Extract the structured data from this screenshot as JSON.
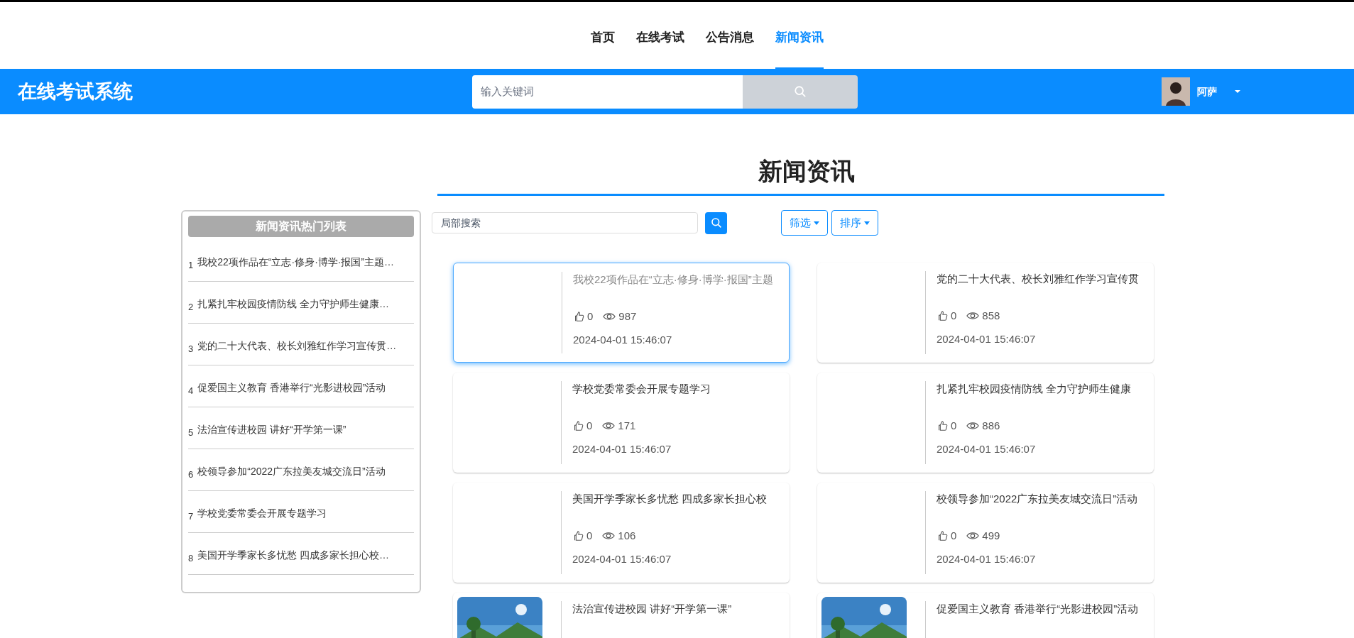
{
  "nav": [
    {
      "label": "首页",
      "selected": false
    },
    {
      "label": "在线考试",
      "selected": false
    },
    {
      "label": "公告消息",
      "selected": false
    },
    {
      "label": "新闻资讯",
      "selected": true
    }
  ],
  "header": {
    "title": "在线考试系统",
    "search": {
      "placeholder": "输入关键词"
    },
    "user": {
      "name": "阿萨"
    }
  },
  "page_title": "新闻资讯",
  "hot_list": {
    "title": "新闻资讯热门列表",
    "items": [
      {
        "rank": "1",
        "title": "我校22项作品在“立志·修身·博学·报国”主题…"
      },
      {
        "rank": "2",
        "title": "扎紧扎牢校园疫情防线 全力守护师生健康…"
      },
      {
        "rank": "3",
        "title": "党的二十大代表、校长刘雅红作学习宣传贯…"
      },
      {
        "rank": "4",
        "title": "促爱国主义教育 香港举行“光影进校园”活动"
      },
      {
        "rank": "5",
        "title": "法治宣传进校园 讲好“开学第一课”"
      },
      {
        "rank": "6",
        "title": "校领导参加“2022广东拉美友城交流日”活动"
      },
      {
        "rank": "7",
        "title": "学校党委常委会开展专题学习"
      },
      {
        "rank": "8",
        "title": "美国开学季家长多忧愁 四成多家长担心校…"
      }
    ]
  },
  "toolbar": {
    "search": {
      "placeholder": "局部搜索"
    },
    "buttons": [
      "筛选",
      "排序"
    ]
  },
  "cards": [
    {
      "title": "我校22项作品在“立志·修身·博学·报国”主题",
      "likes": "0",
      "views": "987",
      "date": "2024-04-01 15:46:07",
      "hovered": true
    },
    {
      "title": "党的二十大代表、校长刘雅红作学习宣传贯",
      "likes": "0",
      "views": "858",
      "date": "2024-04-01 15:46:07",
      "hovered": false
    },
    {
      "title": "学校党委常委会开展专题学习",
      "likes": "0",
      "views": "171",
      "date": "2024-04-01 15:46:07",
      "hovered": false
    },
    {
      "title": "扎紧扎牢校园疫情防线 全力守护师生健康",
      "likes": "0",
      "views": "886",
      "date": "2024-04-01 15:46:07",
      "hovered": false
    },
    {
      "title": "美国开学季家长多忧愁 四成多家长担心校",
      "likes": "0",
      "views": "106",
      "date": "2024-04-01 15:46:07",
      "hovered": false
    },
    {
      "title": "校领导参加“2022广东拉美友城交流日”活动",
      "likes": "0",
      "views": "499",
      "date": "2024-04-01 15:46:07",
      "hovered": false
    },
    {
      "title": "法治宣传进校园 讲好“开学第一课”",
      "picture": true,
      "hovered": false
    },
    {
      "title": "促爱国主义教育 香港举行“光影进校园”活动",
      "picture": true,
      "hovered": false
    }
  ]
}
